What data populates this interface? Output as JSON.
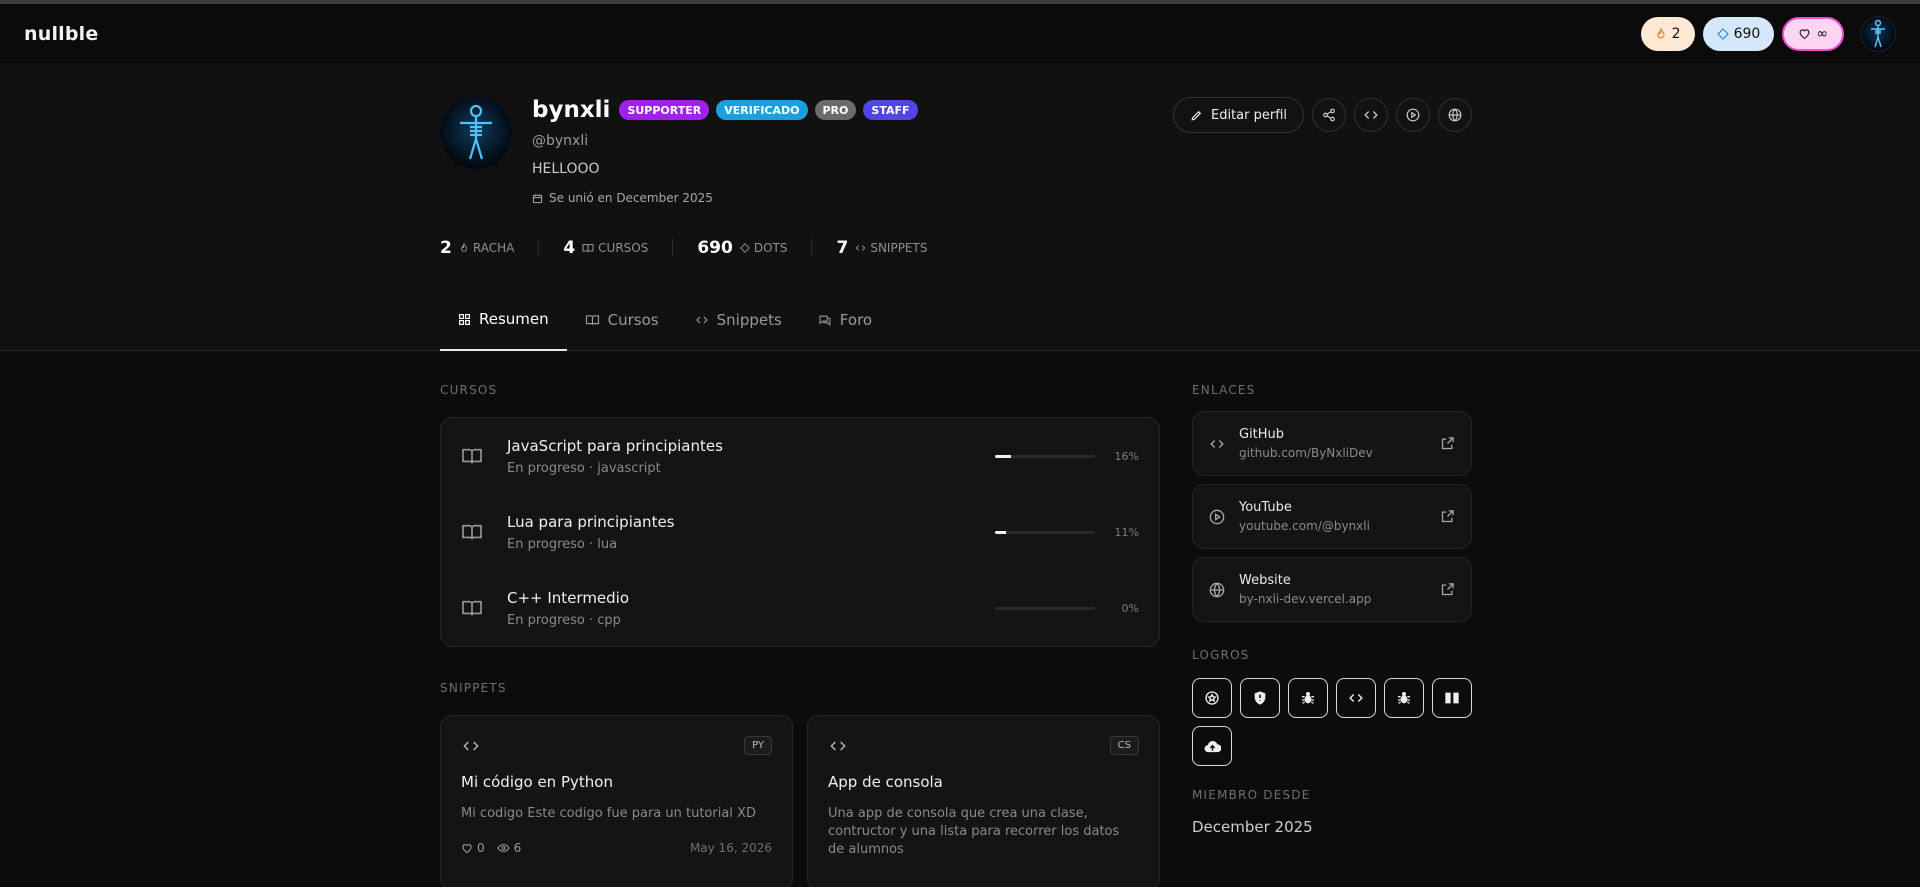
{
  "app": {
    "logo": "nullble"
  },
  "topbar": {
    "streak": "2",
    "dots": "690",
    "lives": "∞"
  },
  "profile": {
    "name": "bynxli",
    "badges": [
      "SUPPORTER",
      "VERIFICADO",
      "PRO",
      "STAFF"
    ],
    "handle": "@bynxli",
    "bio": "HELLOOO",
    "joined": "Se unió en December 2025",
    "edit_label": "Editar perfil"
  },
  "stats": [
    {
      "value": "2",
      "label": "RACHA"
    },
    {
      "value": "4",
      "label": "CURSOS"
    },
    {
      "value": "690",
      "label": "DOTS"
    },
    {
      "value": "7",
      "label": "SNIPPETS"
    }
  ],
  "tabs": [
    {
      "label": "Resumen"
    },
    {
      "label": "Cursos"
    },
    {
      "label": "Snippets"
    },
    {
      "label": "Foro"
    }
  ],
  "courses": {
    "title": "CURSOS",
    "items": [
      {
        "title": "JavaScript para principiantes",
        "sub": "En progreso · javascript",
        "progress": 16,
        "pct": "16%"
      },
      {
        "title": "Lua para principiantes",
        "sub": "En progreso · lua",
        "progress": 11,
        "pct": "11%"
      },
      {
        "title": "C++ Intermedio",
        "sub": "En progreso · cpp",
        "progress": 0,
        "pct": "0%"
      }
    ]
  },
  "snippets": {
    "title": "SNIPPETS",
    "items": [
      {
        "lang": "PY",
        "title": "Mi código en Python",
        "desc": "Mi codigo Este codigo fue para un tutorial XD",
        "likes": "0",
        "views": "6",
        "date": "May 16, 2026"
      },
      {
        "lang": "CS",
        "title": "App de consola",
        "desc": "Una app de consola que crea una clase, contructor y una lista para recorrer los datos de alumnos"
      }
    ]
  },
  "links": {
    "title": "ENLACES",
    "items": [
      {
        "title": "GitHub",
        "url": "github.com/ByNxliDev",
        "icon": "code-icon"
      },
      {
        "title": "YouTube",
        "url": "youtube.com/@bynxli",
        "icon": "play-icon"
      },
      {
        "title": "Website",
        "url": "by-nxli-dev.vercel.app",
        "icon": "globe-icon"
      }
    ]
  },
  "achievements": {
    "title": "LOGROS",
    "items": [
      "star-icon",
      "shield-icon",
      "bug-icon",
      "code-icon",
      "bug-icon",
      "book-icon",
      "cloud-upload-icon"
    ]
  },
  "member": {
    "title": "MIEMBRO DESDE",
    "value": "December 2025"
  },
  "colors": {
    "accent": "#f2f2f2",
    "supporter": "#a020f0",
    "verified": "#1aa0e0",
    "pro": "#6b6b6b",
    "staff": "#4f46e5"
  }
}
